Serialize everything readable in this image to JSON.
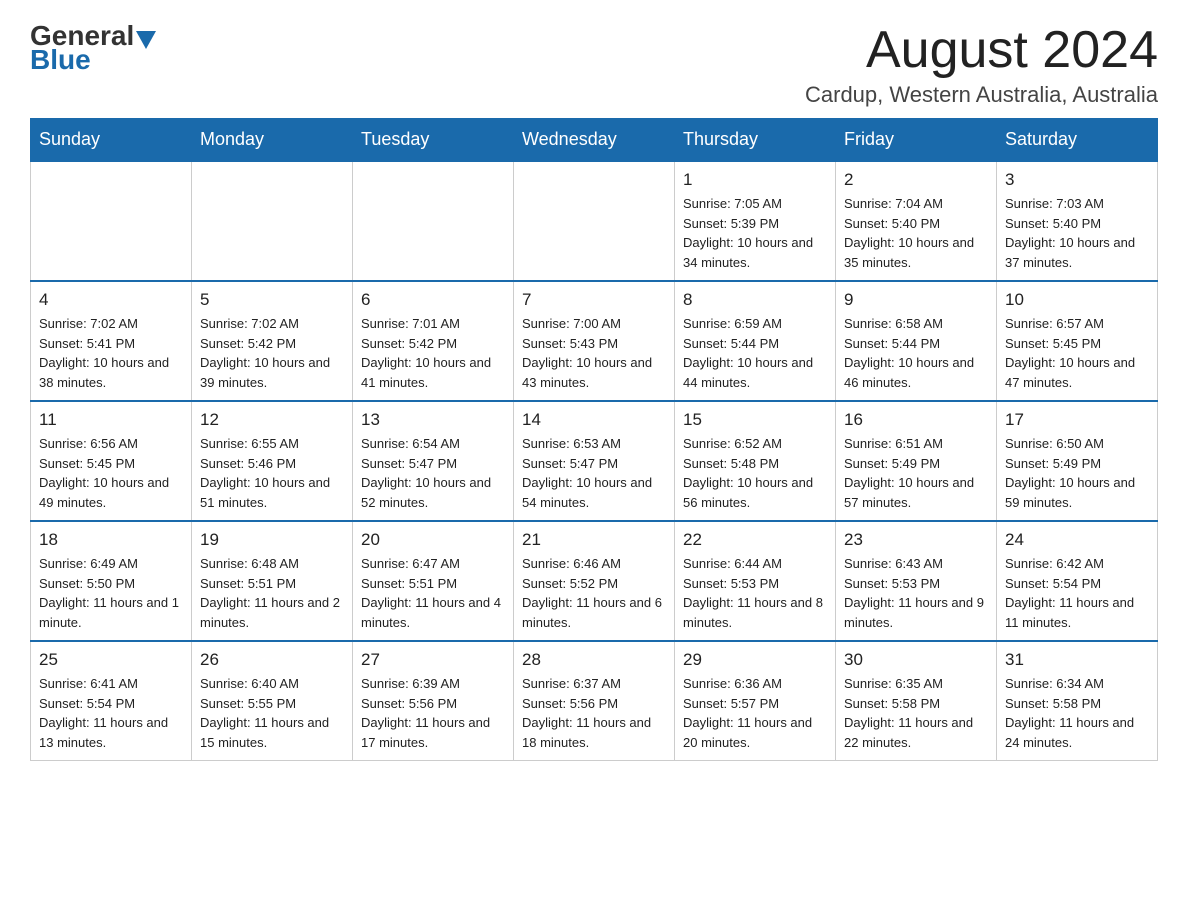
{
  "header": {
    "logo_general": "General",
    "logo_blue": "Blue",
    "month_title": "August 2024",
    "location": "Cardup, Western Australia, Australia"
  },
  "weekdays": [
    "Sunday",
    "Monday",
    "Tuesday",
    "Wednesday",
    "Thursday",
    "Friday",
    "Saturday"
  ],
  "weeks": [
    [
      {
        "day": "",
        "info": ""
      },
      {
        "day": "",
        "info": ""
      },
      {
        "day": "",
        "info": ""
      },
      {
        "day": "",
        "info": ""
      },
      {
        "day": "1",
        "info": "Sunrise: 7:05 AM\nSunset: 5:39 PM\nDaylight: 10 hours and 34 minutes."
      },
      {
        "day": "2",
        "info": "Sunrise: 7:04 AM\nSunset: 5:40 PM\nDaylight: 10 hours and 35 minutes."
      },
      {
        "day": "3",
        "info": "Sunrise: 7:03 AM\nSunset: 5:40 PM\nDaylight: 10 hours and 37 minutes."
      }
    ],
    [
      {
        "day": "4",
        "info": "Sunrise: 7:02 AM\nSunset: 5:41 PM\nDaylight: 10 hours and 38 minutes."
      },
      {
        "day": "5",
        "info": "Sunrise: 7:02 AM\nSunset: 5:42 PM\nDaylight: 10 hours and 39 minutes."
      },
      {
        "day": "6",
        "info": "Sunrise: 7:01 AM\nSunset: 5:42 PM\nDaylight: 10 hours and 41 minutes."
      },
      {
        "day": "7",
        "info": "Sunrise: 7:00 AM\nSunset: 5:43 PM\nDaylight: 10 hours and 43 minutes."
      },
      {
        "day": "8",
        "info": "Sunrise: 6:59 AM\nSunset: 5:44 PM\nDaylight: 10 hours and 44 minutes."
      },
      {
        "day": "9",
        "info": "Sunrise: 6:58 AM\nSunset: 5:44 PM\nDaylight: 10 hours and 46 minutes."
      },
      {
        "day": "10",
        "info": "Sunrise: 6:57 AM\nSunset: 5:45 PM\nDaylight: 10 hours and 47 minutes."
      }
    ],
    [
      {
        "day": "11",
        "info": "Sunrise: 6:56 AM\nSunset: 5:45 PM\nDaylight: 10 hours and 49 minutes."
      },
      {
        "day": "12",
        "info": "Sunrise: 6:55 AM\nSunset: 5:46 PM\nDaylight: 10 hours and 51 minutes."
      },
      {
        "day": "13",
        "info": "Sunrise: 6:54 AM\nSunset: 5:47 PM\nDaylight: 10 hours and 52 minutes."
      },
      {
        "day": "14",
        "info": "Sunrise: 6:53 AM\nSunset: 5:47 PM\nDaylight: 10 hours and 54 minutes."
      },
      {
        "day": "15",
        "info": "Sunrise: 6:52 AM\nSunset: 5:48 PM\nDaylight: 10 hours and 56 minutes."
      },
      {
        "day": "16",
        "info": "Sunrise: 6:51 AM\nSunset: 5:49 PM\nDaylight: 10 hours and 57 minutes."
      },
      {
        "day": "17",
        "info": "Sunrise: 6:50 AM\nSunset: 5:49 PM\nDaylight: 10 hours and 59 minutes."
      }
    ],
    [
      {
        "day": "18",
        "info": "Sunrise: 6:49 AM\nSunset: 5:50 PM\nDaylight: 11 hours and 1 minute."
      },
      {
        "day": "19",
        "info": "Sunrise: 6:48 AM\nSunset: 5:51 PM\nDaylight: 11 hours and 2 minutes."
      },
      {
        "day": "20",
        "info": "Sunrise: 6:47 AM\nSunset: 5:51 PM\nDaylight: 11 hours and 4 minutes."
      },
      {
        "day": "21",
        "info": "Sunrise: 6:46 AM\nSunset: 5:52 PM\nDaylight: 11 hours and 6 minutes."
      },
      {
        "day": "22",
        "info": "Sunrise: 6:44 AM\nSunset: 5:53 PM\nDaylight: 11 hours and 8 minutes."
      },
      {
        "day": "23",
        "info": "Sunrise: 6:43 AM\nSunset: 5:53 PM\nDaylight: 11 hours and 9 minutes."
      },
      {
        "day": "24",
        "info": "Sunrise: 6:42 AM\nSunset: 5:54 PM\nDaylight: 11 hours and 11 minutes."
      }
    ],
    [
      {
        "day": "25",
        "info": "Sunrise: 6:41 AM\nSunset: 5:54 PM\nDaylight: 11 hours and 13 minutes."
      },
      {
        "day": "26",
        "info": "Sunrise: 6:40 AM\nSunset: 5:55 PM\nDaylight: 11 hours and 15 minutes."
      },
      {
        "day": "27",
        "info": "Sunrise: 6:39 AM\nSunset: 5:56 PM\nDaylight: 11 hours and 17 minutes."
      },
      {
        "day": "28",
        "info": "Sunrise: 6:37 AM\nSunset: 5:56 PM\nDaylight: 11 hours and 18 minutes."
      },
      {
        "day": "29",
        "info": "Sunrise: 6:36 AM\nSunset: 5:57 PM\nDaylight: 11 hours and 20 minutes."
      },
      {
        "day": "30",
        "info": "Sunrise: 6:35 AM\nSunset: 5:58 PM\nDaylight: 11 hours and 22 minutes."
      },
      {
        "day": "31",
        "info": "Sunrise: 6:34 AM\nSunset: 5:58 PM\nDaylight: 11 hours and 24 minutes."
      }
    ]
  ]
}
